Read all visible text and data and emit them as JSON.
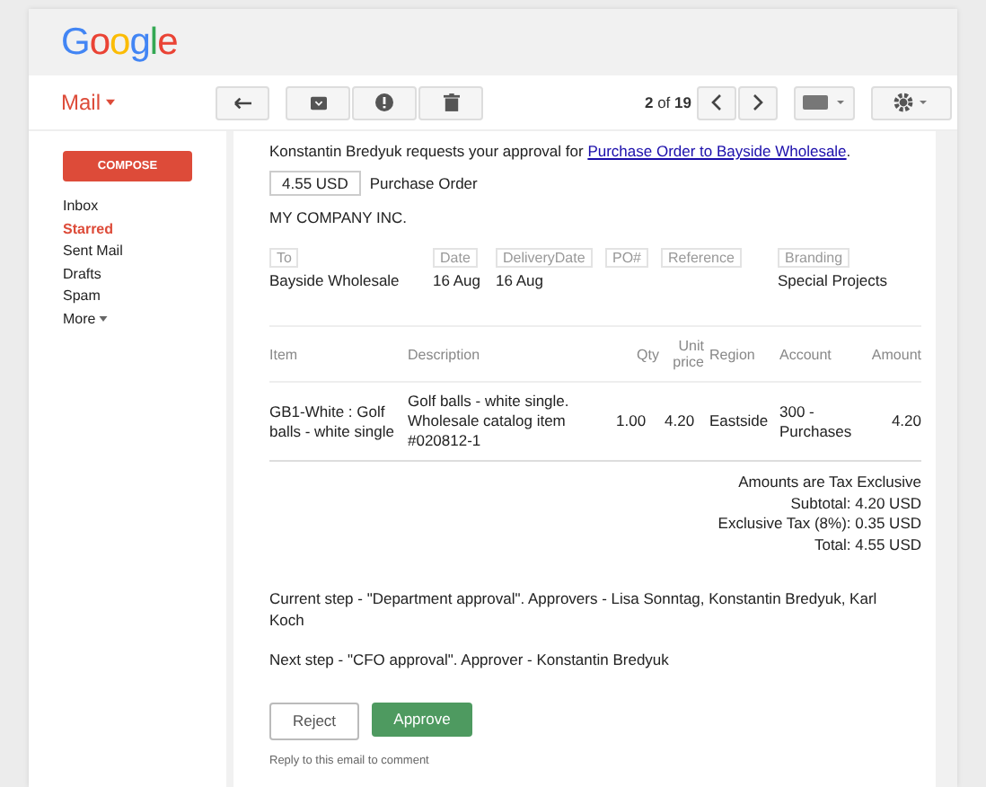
{
  "logo": "Google",
  "app_menu": {
    "label": "Mail"
  },
  "compose": "COMPOSE",
  "sidebar": {
    "items": [
      {
        "label": "Inbox",
        "selected": false
      },
      {
        "label": "Starred",
        "selected": true
      },
      {
        "label": "Sent Mail",
        "selected": false
      },
      {
        "label": "Drafts",
        "selected": false
      },
      {
        "label": "Spam",
        "selected": false
      },
      {
        "label": "More",
        "selected": false
      }
    ]
  },
  "pager": {
    "current": "2",
    "of": "of",
    "total": "19"
  },
  "email": {
    "intro": "Konstantin Bredyuk requests your approval for ",
    "link": "Purchase Order to Bayside Wholesale",
    "intro_end": ".",
    "amount": "4.55 USD",
    "doc_type": "Purchase Order",
    "company": "MY COMPANY INC.",
    "fields": [
      {
        "label": "To",
        "value": "Bayside Wholesale"
      },
      {
        "label": "Date",
        "value": "16 Aug"
      },
      {
        "label": "DeliveryDate",
        "value": "16 Aug"
      },
      {
        "label": "PO#"
      },
      {
        "label": "Reference"
      },
      {
        "label": "Branding",
        "value": "Special Projects"
      }
    ],
    "table": {
      "columns": [
        "Item",
        "Description",
        "Qty",
        "Unit price",
        "Region",
        "Account",
        "Amount"
      ],
      "rows": [
        [
          "GB1-White : Golf balls - white single",
          "Golf balls - white single. Wholesale catalog item #020812-1",
          "1.00",
          "4.20",
          "Eastside",
          "300 - Purchases",
          "4.20"
        ]
      ]
    },
    "totals": [
      "Amounts are Tax Exclusive",
      "Subtotal: 4.20 USD",
      "Exclusive Tax (8%): 0.35 USD",
      "Total: 4.55 USD"
    ],
    "steps": [
      "Current step - \"Department approval\". Approvers - Lisa Sonntag, Konstantin Bredyuk, Karl Koch",
      "Next step - \"CFO approval\". Approver - Konstantin Bredyuk"
    ],
    "buttons": [
      {
        "label": "Reject",
        "kind": "secondary"
      },
      {
        "label": "Approve",
        "kind": "primary"
      }
    ],
    "footer": "Reply to this email to comment"
  }
}
